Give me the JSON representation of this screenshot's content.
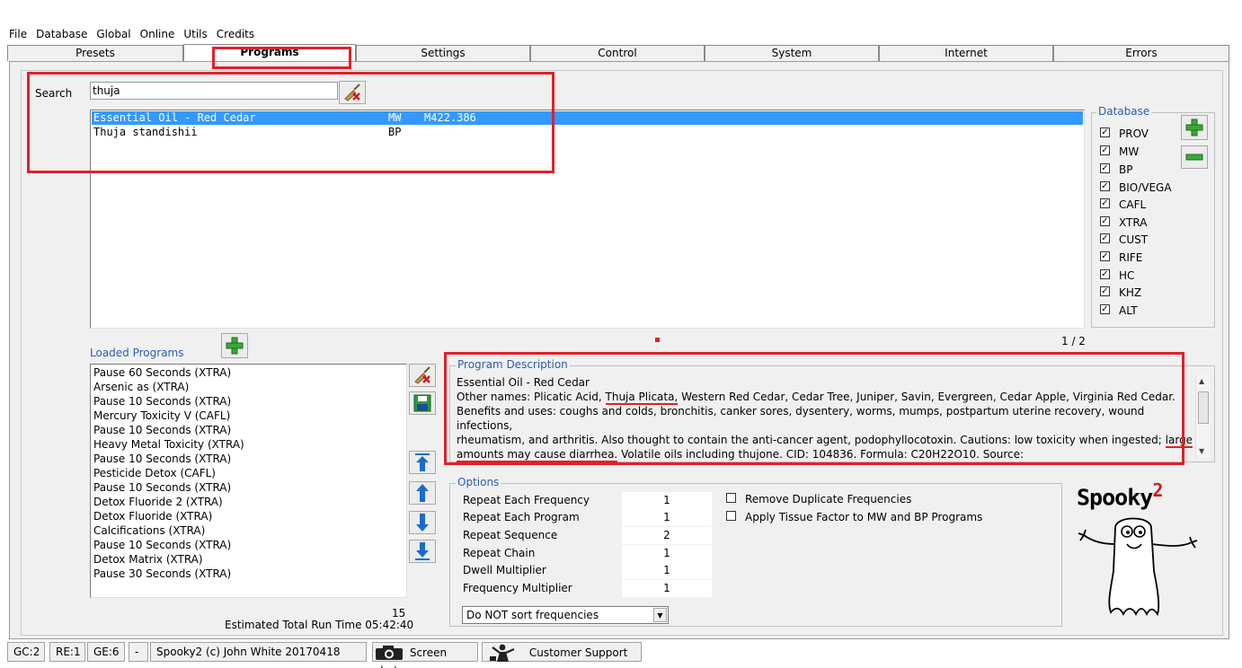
{
  "menu": [
    "File",
    "Database",
    "Global",
    "Online",
    "Utils",
    "Credits"
  ],
  "tabs": [
    "Presets",
    "Programs",
    "Settings",
    "Control",
    "System",
    "Internet",
    "Errors"
  ],
  "search": {
    "label": "Search",
    "value": "thuja"
  },
  "results": [
    {
      "name": "Essential Oil - Red Cedar",
      "db": "MW",
      "code": "M422.386"
    },
    {
      "name": "Thuja standishii",
      "db": "BP",
      "code": ""
    }
  ],
  "database": {
    "title": "Database",
    "items": [
      "PROV",
      "MW",
      "BP",
      "BIO/VEGA",
      "CAFL",
      "XTRA",
      "CUST",
      "RIFE",
      "HC",
      "KHZ",
      "ALT"
    ],
    "check_mark": "✓"
  },
  "pagination": "1 / 2",
  "loaded": {
    "title": "Loaded Programs",
    "items": [
      "Pause 60 Seconds (XTRA)",
      "Arsenic as (XTRA)",
      "Pause 10 Seconds (XTRA)",
      "Mercury Toxicity V (CAFL)",
      "Pause 10 Seconds (XTRA)",
      "Heavy Metal Toxicity (XTRA)",
      "Pause 10 Seconds (XTRA)",
      "Pesticide Detox (CAFL)",
      "Pause 10 Seconds (XTRA)",
      "Detox Fluoride 2 (XTRA)",
      "Detox Fluoride (XTRA)",
      "Calcifications (XTRA)",
      "Pause 10 Seconds (XTRA)",
      "Detox Matrix (XTRA)",
      "Pause 30 Seconds (XTRA)"
    ],
    "count": "15",
    "run_time": "Estimated Total Run Time 05:42:40"
  },
  "description": {
    "title": "Program Description",
    "heading": "Essential Oil - Red Cedar",
    "l1_a": "Other names: Plicatic Acid, ",
    "l1_u": "Thuja Plicata,",
    "l1_b": " Western Red Cedar, Cedar Tree, Juniper, Savin, Evergreen, Cedar Apple, Virginia Red Cedar.",
    "l2": "Benefits and uses:  coughs and colds, bronchitis, canker sores, dysentery, worms, mumps, postpartum uterine recovery, wound infections,",
    "l3_a": "rheumatism, and arthritis. Also thought to contain the anti-cancer agent, podophyllocotoxin. Cautions: low toxicity when ingested; ",
    "l3_u": "large",
    "l4_u": "amounts may cause diarrhea.",
    "l4_b": " Volatile oils including thujone. CID: 104836. Formula: C20H22O10. Source:"
  },
  "options": {
    "title": "Options",
    "rows": [
      {
        "label": "Repeat Each Frequency",
        "value": "1"
      },
      {
        "label": "Repeat Each Program",
        "value": "1"
      },
      {
        "label": "Repeat Sequence",
        "value": "2"
      },
      {
        "label": "Repeat Chain",
        "value": "1"
      },
      {
        "label": "Dwell Multiplier",
        "value": "1"
      },
      {
        "label": "Frequency Multiplier",
        "value": "1"
      }
    ],
    "checks": [
      "Remove Duplicate Frequencies",
      "Apply Tissue Factor to MW and BP Programs"
    ],
    "sort": "Do NOT sort frequencies"
  },
  "logo": {
    "text": "Spooky",
    "sup": "2"
  },
  "status": [
    "GC:2",
    "RE:1",
    "GE:6",
    "-",
    "Spooky2 (c) John White 20170418"
  ],
  "screenshot_label": "Screen shot",
  "support_label": "Customer Support",
  "colors": {
    "accent": "#3399ff",
    "highlight": "#e0202a",
    "legend": "#2a5db0"
  }
}
